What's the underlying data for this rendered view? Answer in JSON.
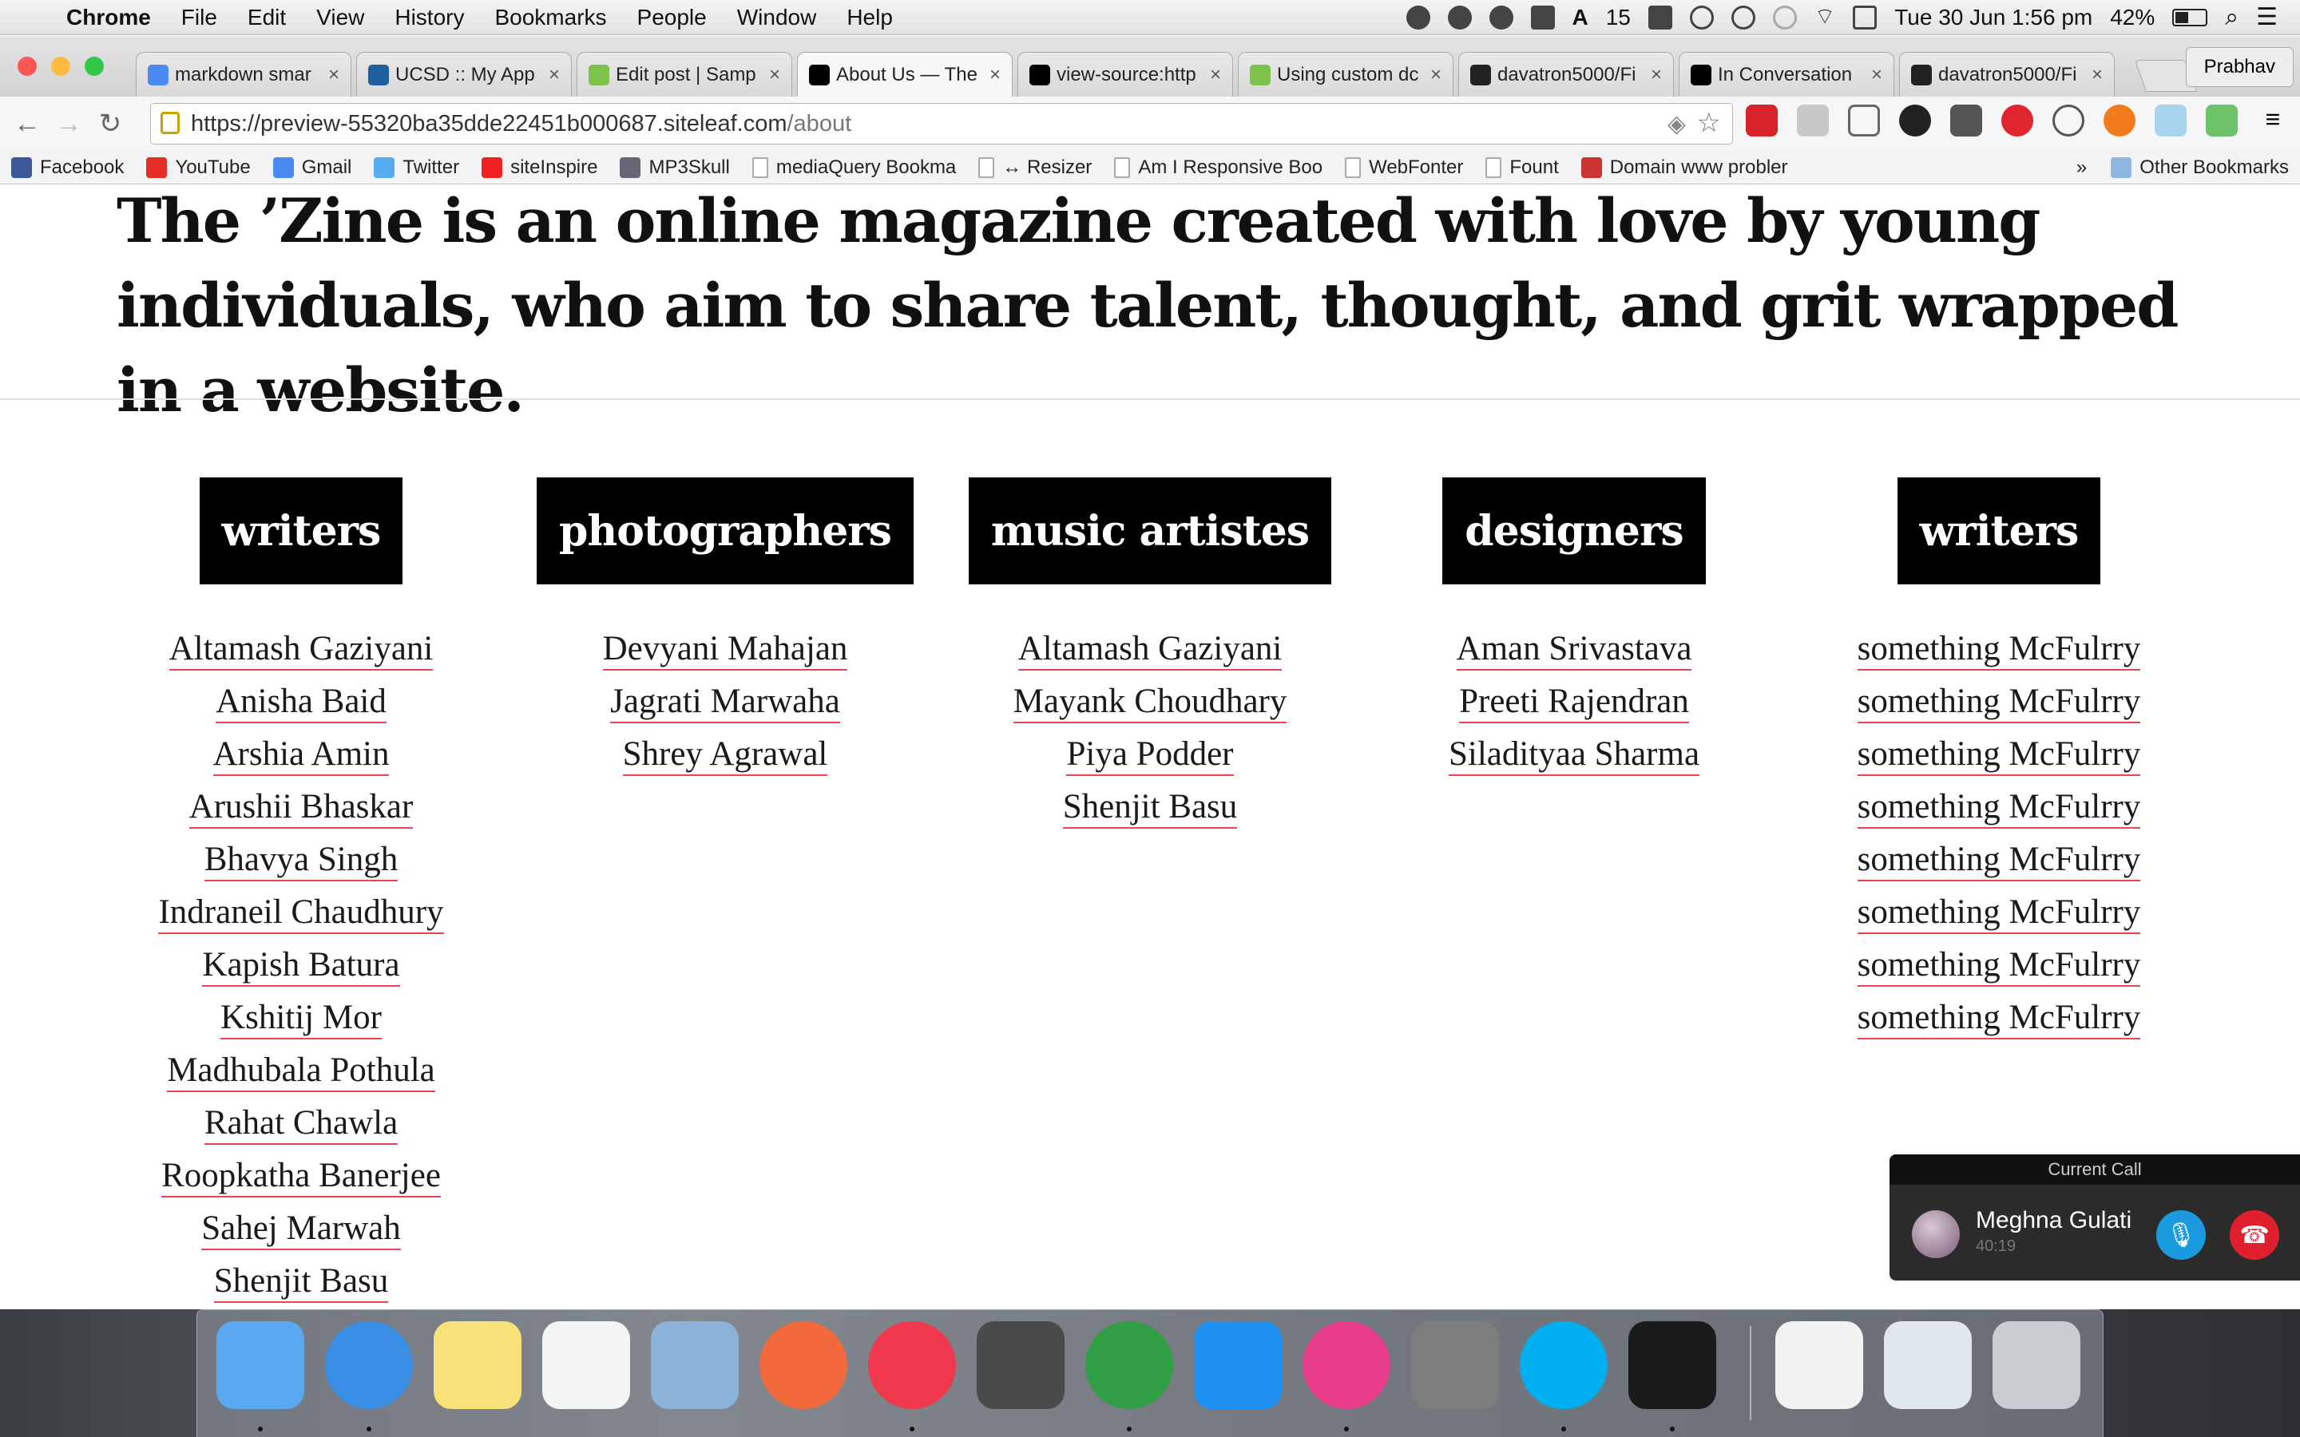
{
  "menubar": {
    "app": "Chrome",
    "items": [
      "File",
      "Edit",
      "View",
      "History",
      "Bookmarks",
      "People",
      "Window",
      "Help"
    ],
    "adobe_count": "15",
    "datetime": "Tue 30 Jun  1:56 pm",
    "battery": "42%"
  },
  "tabs": [
    {
      "title": "markdown smar",
      "favicon": "google-icon",
      "color": "#4a8af4"
    },
    {
      "title": "UCSD :: My App",
      "favicon": "ucsd-icon",
      "color": "#1f5fa0"
    },
    {
      "title": "Edit post | Samp",
      "favicon": "siteleaf-icon",
      "color": "#7dc24b"
    },
    {
      "title": "About Us — The",
      "favicon": "zine-icon",
      "color": "#000000"
    },
    {
      "title": "view-source:http",
      "favicon": "zine-icon",
      "color": "#000000"
    },
    {
      "title": "Using custom dc",
      "favicon": "siteleaf-icon",
      "color": "#7dc24b"
    },
    {
      "title": "davatron5000/Fi",
      "favicon": "github-icon",
      "color": "#222222"
    },
    {
      "title": "In Conversation",
      "favicon": "zine-icon",
      "color": "#000000"
    },
    {
      "title": "davatron5000/Fi",
      "favicon": "github-icon",
      "color": "#222222"
    }
  ],
  "profile": "Prabhav",
  "url": {
    "base": "https://preview-55320ba35dde22451b000687.siteleaf.com",
    "path": "/about"
  },
  "bookmarks": [
    {
      "label": "Facebook",
      "icon": "facebook-icon",
      "color": "#3b5998"
    },
    {
      "label": "YouTube",
      "icon": "youtube-icon",
      "color": "#e52d27"
    },
    {
      "label": "Gmail",
      "icon": "google-icon",
      "color": "#4a8af4"
    },
    {
      "label": "Twitter",
      "icon": "twitter-icon",
      "color": "#55acee"
    },
    {
      "label": "siteInspire",
      "icon": "siteinspire-icon",
      "color": "#e22"
    },
    {
      "label": "MP3Skull",
      "icon": "mp3skull-icon",
      "color": "#667"
    },
    {
      "label": "mediaQuery Bookma",
      "icon": "page-icon",
      "color": ""
    },
    {
      "label": "↔ Resizer",
      "icon": "page-icon",
      "color": ""
    },
    {
      "label": "Am I Responsive Boo",
      "icon": "page-icon",
      "color": ""
    },
    {
      "label": "WebFonter",
      "icon": "page-icon",
      "color": ""
    },
    {
      "label": "Fount",
      "icon": "page-icon",
      "color": ""
    },
    {
      "label": "Domain www probler",
      "icon": "wikipedia-icon",
      "color": "#c33"
    }
  ],
  "bookmarks_more": "»",
  "bookmarks_other": "Other Bookmarks",
  "page": {
    "intro": "The ’Zine is an online magazine created with love by young individuals, who aim to share talent, thought, and grit wrapped in a website.",
    "columns": [
      {
        "heading": "writers",
        "names": [
          "Altamash Gaziyani",
          "Anisha Baid",
          "Arshia Amin",
          "Arushii Bhaskar",
          "Bhavya Singh",
          "Indraneil Chaudhury",
          "Kapish Batura",
          "Kshitij Mor",
          "Madhubala Pothula",
          "Rahat Chawla",
          "Roopkatha Banerjee",
          "Sahej Marwah",
          "Shenjit Basu"
        ]
      },
      {
        "heading": "photographers",
        "names": [
          "Devyani Mahajan",
          "Jagrati Marwaha",
          "Shrey Agrawal"
        ]
      },
      {
        "heading": "music artistes",
        "names": [
          "Altamash Gaziyani",
          "Mayank Choudhary",
          "Piya Podder",
          "Shenjit Basu"
        ]
      },
      {
        "heading": "designers",
        "names": [
          "Aman Srivastava",
          "Preeti Rajendran",
          "Siladityaa Sharma"
        ]
      },
      {
        "heading": "writers",
        "names": [
          "something McFulrry",
          "something McFulrry",
          "something McFulrry",
          "something McFulrry",
          "something McFulrry",
          "something McFulrry",
          "something McFulrry",
          "something McFulrry"
        ]
      }
    ]
  },
  "call": {
    "title": "Current Call",
    "name": "Meghna Gulati",
    "duration": "40:19"
  },
  "dock": [
    {
      "name": "finder-icon",
      "color": "#5aa8f0"
    },
    {
      "name": "safari-icon",
      "color": "#3a8ee6"
    },
    {
      "name": "notes-icon",
      "color": "#f7e27a"
    },
    {
      "name": "reminders-icon",
      "color": "#f4f4f4"
    },
    {
      "name": "mail-icon",
      "color": "#8bb2d8"
    },
    {
      "name": "sunrise-icon",
      "color": "#f26a3b"
    },
    {
      "name": "itunes-icon",
      "color": "#f0394d"
    },
    {
      "name": "sublime-icon",
      "color": "#4a4a4a"
    },
    {
      "name": "chrome-icon",
      "color": "#2f9e44"
    },
    {
      "name": "appstore-icon",
      "color": "#1f8ff0"
    },
    {
      "name": "colorsync-icon",
      "color": "#e83e8c"
    },
    {
      "name": "system-preferences-icon",
      "color": "#7d7d7d"
    },
    {
      "name": "skype-icon",
      "color": "#00aff0"
    },
    {
      "name": "terminal-icon",
      "color": "#1b1b1b"
    },
    {
      "name": "document-icon",
      "color": "#f2f2f2"
    },
    {
      "name": "downloads-stack-icon",
      "color": "#dfe6ee"
    },
    {
      "name": "trash-icon",
      "color": "#c9ccd0"
    }
  ]
}
